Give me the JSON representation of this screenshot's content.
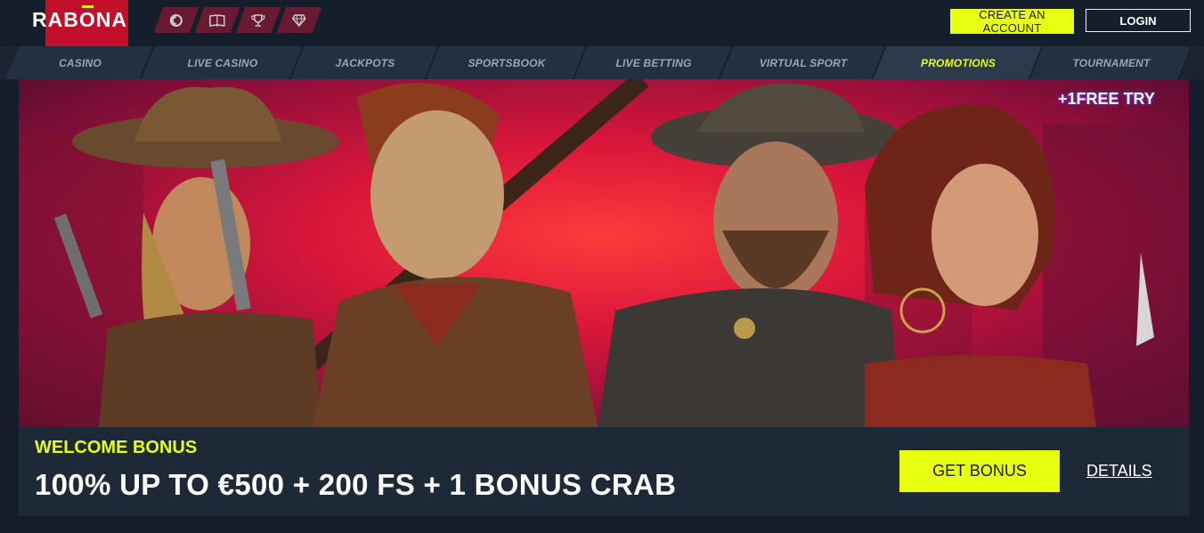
{
  "brand": {
    "logo_text": "RABONA",
    "accent": "#e8ff10",
    "brand_red": "#c3102a"
  },
  "header": {
    "icon_tabs": [
      "casino-chip-icon",
      "book-icon",
      "trophy-icon",
      "diamond-icon"
    ],
    "create_account_label": "CREATE AN ACCOUNT",
    "login_label": "LOGIN"
  },
  "nav": {
    "items": [
      {
        "label": "CASINO",
        "active": false
      },
      {
        "label": "LIVE CASINO",
        "active": false
      },
      {
        "label": "JACKPOTS",
        "active": false
      },
      {
        "label": "SPORTSBOOK",
        "active": false
      },
      {
        "label": "LIVE BETTING",
        "active": false
      },
      {
        "label": "VIRTUAL SPORT",
        "active": false
      },
      {
        "label": "PROMOTIONS",
        "active": true
      },
      {
        "label": "TOURNAMENT",
        "active": false
      }
    ]
  },
  "hero": {
    "badge_text": "+1FREE TRY"
  },
  "promo": {
    "heading": "WELCOME BONUS",
    "offer": "100% UP TO €500 + 200 FS + 1 BONUS CRAB",
    "get_bonus_label": "GET BONUS",
    "details_label": "DETAILS"
  }
}
